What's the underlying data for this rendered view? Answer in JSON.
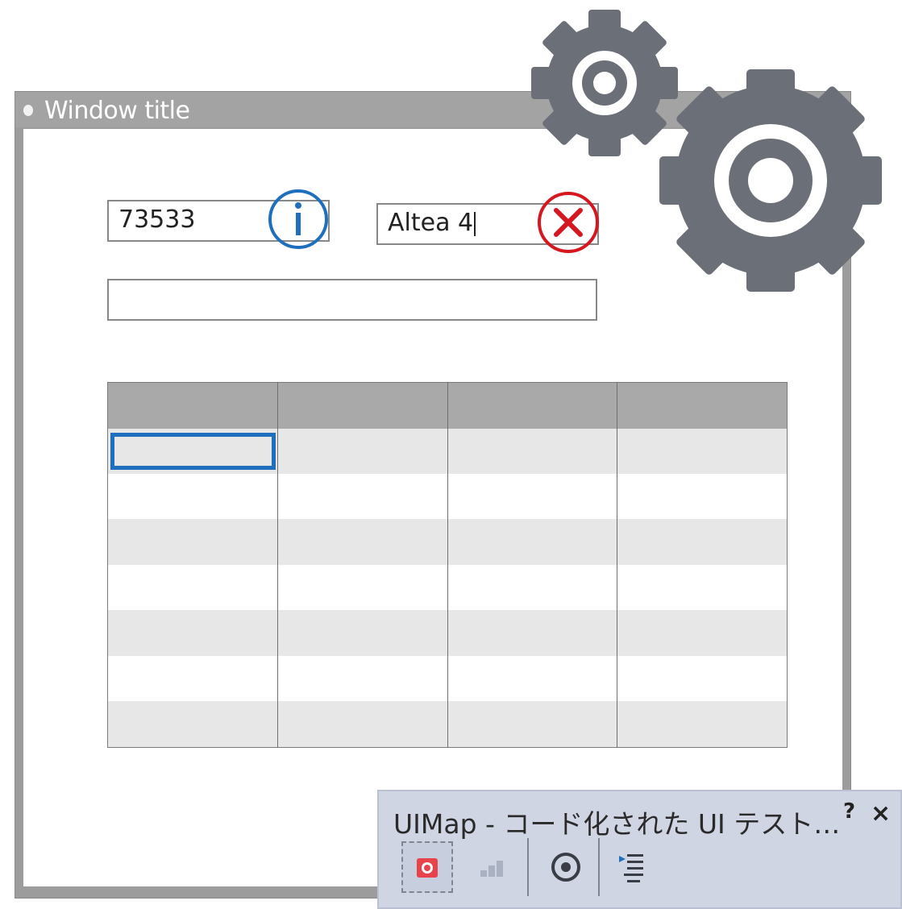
{
  "window": {
    "title": "Window title",
    "field_number": "73533",
    "field_text": "Altea 4",
    "field_wide": "",
    "grid_columns": 4,
    "grid_rows": 7,
    "info_icon_color": "#1e6fbd",
    "error_icon_color": "#d5181f"
  },
  "gears": {
    "color": "#6b6f78",
    "icons": [
      "gear-small-icon",
      "gear-large-icon"
    ]
  },
  "uimap_panel": {
    "title": "UIMap - コード化された UI テスト…",
    "help": "?",
    "close": "×",
    "buttons": [
      "record-icon",
      "steps-icon",
      "crosshair-icon",
      "generate-code-icon"
    ]
  }
}
